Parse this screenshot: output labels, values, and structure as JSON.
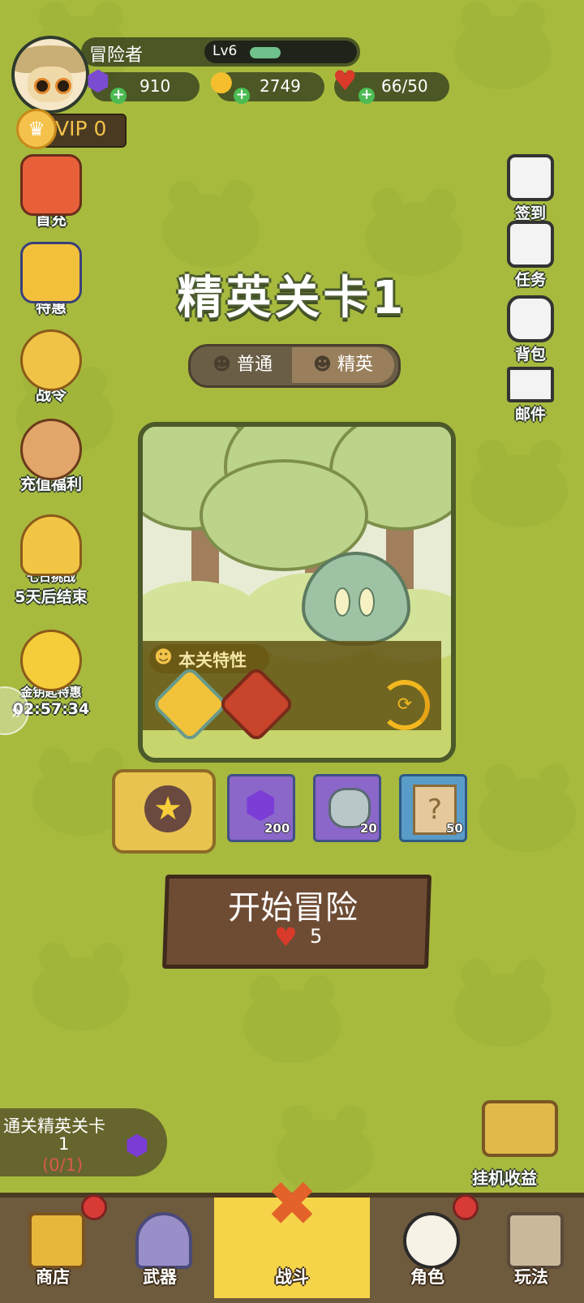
{
  "player": {
    "name": "冒险者",
    "level": "Lv6",
    "level_progress": 0.2
  },
  "resources": {
    "gems": "910",
    "gold": "2749",
    "stamina": "66/50"
  },
  "vip": {
    "label": "VIP 0"
  },
  "left_menu": [
    {
      "label": "首充",
      "icon": "gift-box-icon"
    },
    {
      "label": "特惠",
      "icon": "cards-icon"
    },
    {
      "label": "战令",
      "icon": "battle-pass-icon"
    },
    {
      "label": "充值福利",
      "icon": "piggy-bank-icon"
    },
    {
      "label": "七日挑战",
      "sub": "5天后结束",
      "icon": "trophy-icon"
    },
    {
      "label": "金钥匙特惠",
      "sub": "02:57:34",
      "icon": "golden-key-icon"
    }
  ],
  "right_menu": [
    {
      "label": "签到",
      "icon": "calendar-icon"
    },
    {
      "label": "任务",
      "icon": "task-list-icon"
    },
    {
      "label": "背包",
      "icon": "backpack-icon"
    },
    {
      "label": "邮件",
      "icon": "mail-icon"
    }
  ],
  "stage": {
    "title": "精英关卡1",
    "modes": [
      "普通",
      "精英"
    ],
    "active_mode": "精英",
    "feature_label": "本关特性"
  },
  "rewards": [
    {
      "name": "gem",
      "qty": "200"
    },
    {
      "name": "stone",
      "qty": "20"
    },
    {
      "name": "scroll",
      "qty": "50"
    }
  ],
  "start": {
    "label": "开始冒险",
    "cost": "5"
  },
  "quest": {
    "line1": "通关精英关卡",
    "line2": "1",
    "progress": "(0/1)"
  },
  "idle": {
    "label": "挂机收益"
  },
  "nav": [
    {
      "label": "商店",
      "icon": "shop-chest-icon",
      "badge": true
    },
    {
      "label": "武器",
      "icon": "weapon-icon",
      "badge": false
    },
    {
      "label": "战斗",
      "icon": "crossed-swords-icon",
      "badge": false,
      "active": true
    },
    {
      "label": "角色",
      "icon": "panda-icon",
      "badge": true
    },
    {
      "label": "玩法",
      "icon": "castle-icon",
      "badge": false
    }
  ],
  "colors": {
    "background": "#a7ba3e",
    "wood": "#6e4c34",
    "active_nav": "#f6d44a",
    "badge_red": "#d83a36"
  }
}
